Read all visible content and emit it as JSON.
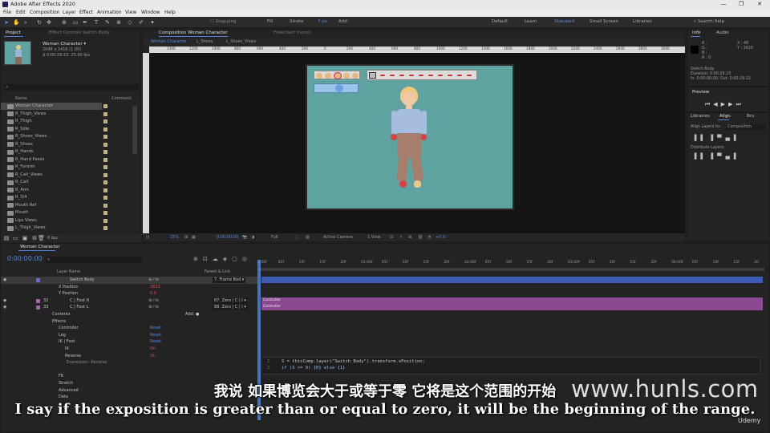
{
  "titlebar": {
    "title": "Adobe After Effects 2020",
    "controls": [
      "—",
      "❒",
      "✕"
    ]
  },
  "menu": [
    "File",
    "Edit",
    "Composition",
    "Layer",
    "Effect",
    "Animation",
    "View",
    "Window",
    "Help"
  ],
  "toolbar": {
    "snapping": "Snapping",
    "fill": "Fill",
    "stroke": "Stroke",
    "stroke_px": "7 px",
    "add": "Add:",
    "workspaces": [
      "Default",
      "Learn",
      "Standard",
      "Small Screen",
      "Libraries"
    ],
    "active_workspace": "Standard",
    "search": "Search Help"
  },
  "project": {
    "tab": "Project",
    "effect_tab": "Effect Controls Switch Body",
    "name": "Woman Character ▾",
    "size": "2048 x 1416 (1.00)",
    "duration": "Δ 0:00:29:23, 25.00 fps",
    "search_placeholder": "⌕",
    "col_name": "Name",
    "col_comment": "Comment",
    "items": [
      "Woman Character",
      "R_Thigh_Views",
      "R_Thigh",
      "R_Side",
      "R_Shoes_Views",
      "R_Shoes",
      "R_Hands",
      "R_Hand Poses",
      "R_Forarm",
      "R_Calf_Views",
      "R_Calf",
      "R_Arm",
      "R_3/4",
      "Mouth Ref",
      "Mouth",
      "Lips Views",
      "L_Thigh_Views"
    ],
    "bpc": "8 bpc"
  },
  "viewer": {
    "tab": "Composition Woman Character",
    "flowchart": "Flowchart (none)",
    "subtabs": [
      "Woman Character",
      "L_Shoes",
      "L_Shoes_Views"
    ],
    "ruler": [
      "1400",
      "1200",
      "1000",
      "800",
      "600",
      "400",
      "200",
      "0",
      "200",
      "400",
      "600",
      "800",
      "1000",
      "1200",
      "1400",
      "1600",
      "1800",
      "2000",
      "2200",
      "2400",
      "2600",
      "2800",
      "3000"
    ],
    "zoom": "25%",
    "timecode": "0:00:00:00",
    "quality": "Full",
    "camera": "Active Camera",
    "views": "1 View",
    "exposure": "+0.0"
  },
  "info": {
    "tab": "Info",
    "audio": "Audio",
    "r": "R :",
    "g": "G :",
    "b": "B :",
    "a": "A :  0",
    "x": "X : 48",
    "y": "Y : 1620",
    "layer": "Switch Body",
    "duration": "Duration: 0:00:29:23",
    "inout": "In: 0:00:00:00, Out: 0:00:29:22"
  },
  "preview": {
    "tab": "Preview"
  },
  "align": {
    "tabs": [
      "Libraries",
      "Align",
      "Bru"
    ],
    "align_to": "Align Layers to:",
    "target": "Composition",
    "distribute": "Distribute Layers:"
  },
  "timeline": {
    "tab": "Woman Character",
    "timecode": "0:00:00:00",
    "search": "⌕",
    "col_layer": "Layer Name",
    "col_parent": "Parent & Link",
    "ruler": [
      "0:00f",
      "05f",
      "10f",
      "15f",
      "20f",
      "01:00f",
      "05f",
      "10f",
      "15f",
      "20f",
      "02:00f",
      "05f",
      "10f",
      "15f",
      "20f",
      "03:00f",
      "05f",
      "10f",
      "15f",
      "20f",
      "04:00f",
      "05f",
      "10f",
      "15f",
      "20"
    ],
    "rows": [
      {
        "num": "",
        "name": "Switch Body",
        "parent": "7. Frame Bod ▾",
        "indent": 0,
        "selected": true
      },
      {
        "num": "",
        "name": "X Position",
        "parent": "",
        "val": "2653",
        "indent": 2
      },
      {
        "num": "",
        "name": "Y Position",
        "parent": "",
        "val": "0.0",
        "indent": 2
      },
      {
        "num": "32",
        "name": "C | Foot R",
        "parent": "87. Zero | C | I ▾",
        "indent": 0
      },
      {
        "num": "33",
        "name": "C | Foot L",
        "parent": "88. Zero | C | I ▾",
        "indent": 0
      },
      {
        "num": "",
        "name": "Contents",
        "parent": "",
        "add": "Add: ●",
        "indent": 1
      },
      {
        "num": "",
        "name": "Effects",
        "parent": "",
        "indent": 1
      },
      {
        "num": "",
        "name": "Controller",
        "parent": "",
        "reset": "Reset",
        "indent": 2
      },
      {
        "num": "",
        "name": "Leg",
        "parent": "",
        "reset": "Reset",
        "indent": 2
      },
      {
        "num": "",
        "name": "IK | Foot",
        "parent": "",
        "reset": "Reset",
        "indent": 2
      },
      {
        "num": "",
        "name": "IK",
        "parent": "",
        "val": "On",
        "indent": 3
      },
      {
        "num": "",
        "name": "Reverse",
        "parent": "",
        "val": "On",
        "indent": 3
      },
      {
        "num": "",
        "name": "Expression: Reverse",
        "parent": "",
        "indent": 4
      },
      {
        "num": "",
        "name": "",
        "parent": "",
        "indent": 0
      },
      {
        "num": "",
        "name": "FK",
        "parent": "",
        "indent": 2
      },
      {
        "num": "",
        "name": "Stretch",
        "parent": "",
        "indent": 2
      },
      {
        "num": "",
        "name": "Advanced",
        "parent": "",
        "indent": 2
      },
      {
        "num": "",
        "name": "Data",
        "parent": "",
        "indent": 2
      }
    ],
    "controller_label": "Controller",
    "code_line1": "S = thisComp.layer(\"Switch Body\").transform.xPosition;",
    "code_line2": "if (S >= 0) {0} else {1}"
  },
  "subtitles": {
    "cn": "我说 如果博览会大于或等于零 它将是这个范围的开始",
    "en": "I say if the exposition is greater than or equal to zero, it will be the beginning of the range."
  },
  "watermark": "www.hunls.com",
  "udemy": "Udemy",
  "colors": {
    "accent": "#4d8ae6",
    "canvas": "#5fa3a0",
    "purple_bar": "#8a4a92",
    "blue_bar": "#3d5bb5",
    "label_tan": "#c8b27a"
  }
}
